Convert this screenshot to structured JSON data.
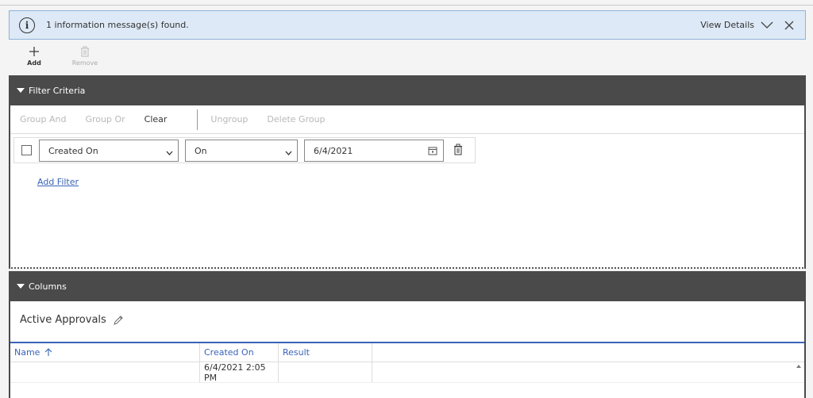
{
  "banner": {
    "message": "1 information message(s) found.",
    "details_label": "View Details",
    "icon": "info-icon",
    "bg_color": "#dde9f6"
  },
  "toolbar": {
    "add_label": "Add",
    "remove_label": "Remove"
  },
  "filter_section": {
    "title": "Filter Criteria",
    "buttons": {
      "group_and": "Group And",
      "group_or": "Group Or",
      "clear": "Clear",
      "ungroup": "Ungroup",
      "delete_group": "Delete Group"
    },
    "row": {
      "field": "Created On",
      "operator": "On",
      "value": "6/4/2021"
    },
    "add_filter_label": "Add Filter"
  },
  "columns_section": {
    "title": "Columns",
    "view_name": "Active Approvals",
    "headers": {
      "name": "Name",
      "created_on": "Created On",
      "result": "Result"
    },
    "rows": [
      {
        "name": "",
        "created_on": "6/4/2021 2:05 PM",
        "result": ""
      }
    ]
  },
  "colors": {
    "header_bg": "#4a4a4a",
    "link": "#3a63b8"
  }
}
